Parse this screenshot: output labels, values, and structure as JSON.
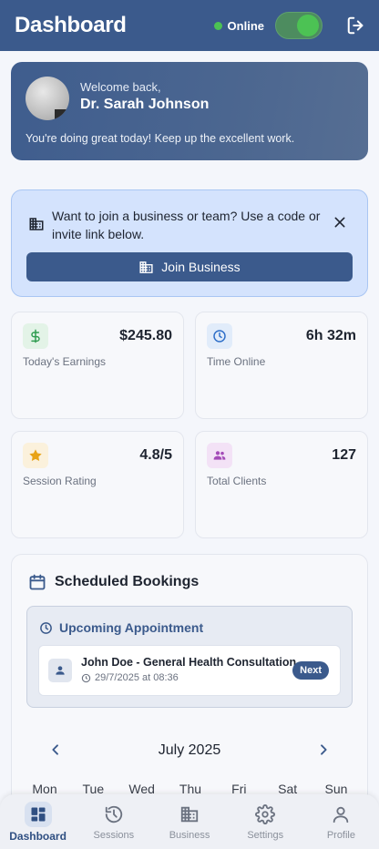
{
  "header": {
    "title": "Dashboard",
    "status_text": "Online",
    "toggle_on": true,
    "logout_icon": "logout-icon"
  },
  "welcome": {
    "greeting": "Welcome back,",
    "name": "Dr. Sarah Johnson",
    "message": "You're doing great today! Keep up the excellent work."
  },
  "join_banner": {
    "text": "Want to join a business or team? Use a code or invite link below.",
    "button_label": "Join Business",
    "icon": "building-icon",
    "close_icon": "close-icon"
  },
  "stats": [
    {
      "value": "$245.80",
      "label": "Today's Earnings",
      "icon": "dollar-icon",
      "color": "#2e9b4f",
      "bg": "#e3f3e7"
    },
    {
      "value": "6h 32m",
      "label": "Time Online",
      "icon": "clock-icon",
      "color": "#2f6fc9",
      "bg": "#e1ecfa"
    },
    {
      "value": "4.8/5",
      "label": "Session Rating",
      "icon": "star-icon",
      "color": "#e8a316",
      "bg": "#fbf1dc"
    },
    {
      "value": "127",
      "label": "Total Clients",
      "icon": "people-icon",
      "color": "#a44bb8",
      "bg": "#f3e2f6"
    }
  ],
  "bookings": {
    "title": "Scheduled Bookings",
    "upcoming_title": "Upcoming Appointment",
    "appointment": {
      "title": "John Doe - General Health Consultation",
      "datetime": "29/7/2025 at 08:36",
      "badge": "Next"
    },
    "calendar": {
      "month": "July 2025",
      "weekdays": [
        "Mon",
        "Tue",
        "Wed",
        "Thu",
        "Fri",
        "Sat",
        "Sun"
      ]
    }
  },
  "nav": [
    {
      "label": "Dashboard",
      "icon": "dashboard-icon",
      "active": true
    },
    {
      "label": "Sessions",
      "icon": "history-icon",
      "active": false
    },
    {
      "label": "Business",
      "icon": "business-icon",
      "active": false
    },
    {
      "label": "Settings",
      "icon": "gear-icon",
      "active": false
    },
    {
      "label": "Profile",
      "icon": "person-icon",
      "active": false
    }
  ],
  "colors": {
    "primary": "#3b5a8c",
    "online": "#4cc254",
    "background": "#f4f6fb"
  }
}
